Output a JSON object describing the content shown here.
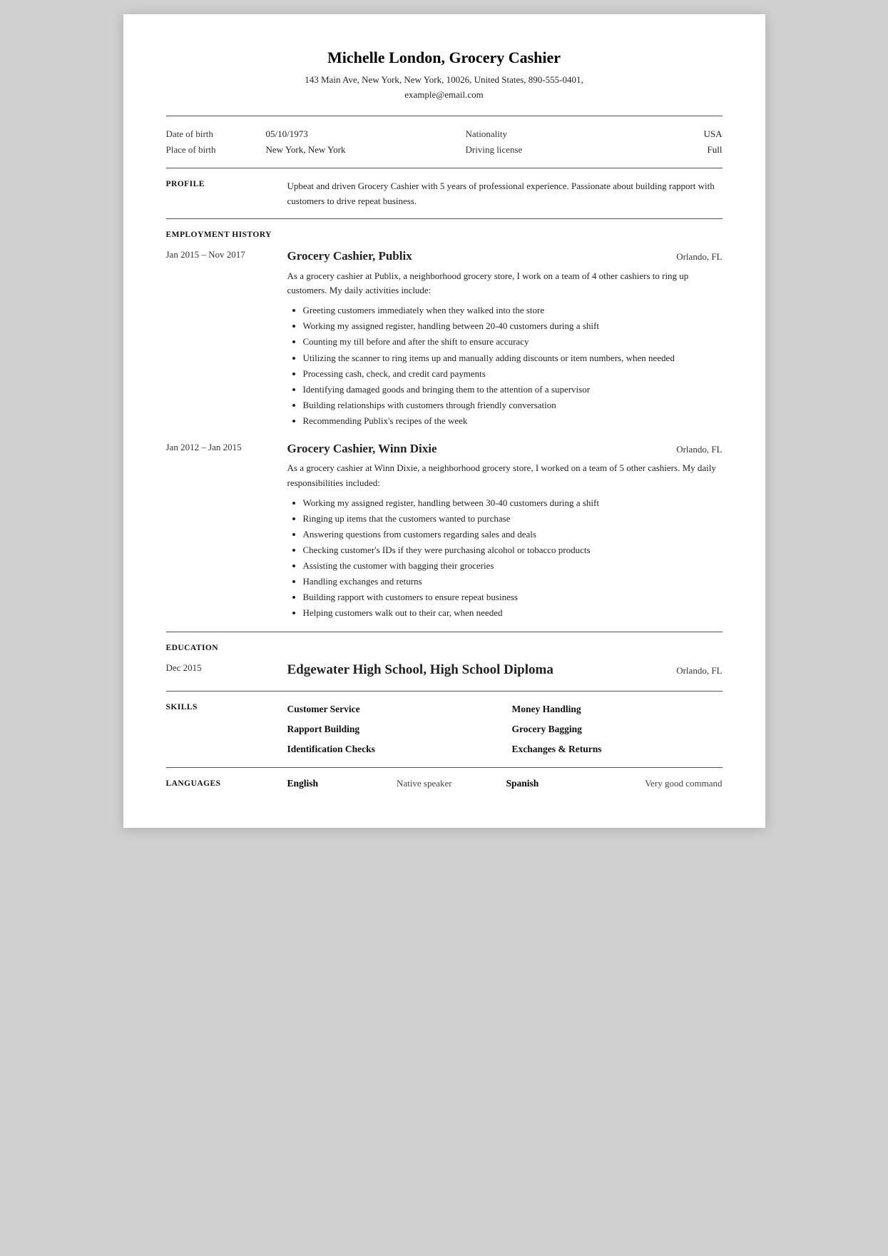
{
  "header": {
    "name": "Michelle London, Grocery Cashier",
    "address": "143 Main Ave, New York, New York, 10026, United States, 890-555-0401,",
    "email": "example@email.com"
  },
  "personal": {
    "dob_label": "Date of birth",
    "dob_value": "05/10/1973",
    "nationality_label": "Nationality",
    "nationality_value": "USA",
    "pob_label": "Place of birth",
    "pob_value": "New York, New York",
    "driving_label": "Driving license",
    "driving_value": "Full"
  },
  "profile": {
    "section_label": "PROFILE",
    "text": "Upbeat and driven Grocery Cashier with 5 years of professional experience. Passionate about building rapport with customers to drive repeat business."
  },
  "employment": {
    "section_label": "EMPLOYMENT HISTORY",
    "jobs": [
      {
        "date": "Jan 2015 – Nov 2017",
        "title": "Grocery Cashier, Publix",
        "location": "Orlando, FL",
        "description": "As a grocery cashier at Publix, a neighborhood grocery store, I work on a team of 4 other cashiers to ring up customers. My daily activities include:",
        "bullets": [
          "Greeting customers immediately when they walked into the store",
          "Working my assigned register, handling between 20-40 customers during a shift",
          "Counting my till before and after the shift to ensure accuracy",
          "Utilizing the scanner to ring items up and manually adding discounts or item numbers, when needed",
          "Processing cash, check, and credit card payments",
          "Identifying damaged goods and bringing them to the attention of a supervisor",
          "Building relationships with customers through friendly conversation",
          "Recommending Publix's recipes of the week"
        ]
      },
      {
        "date": "Jan 2012 – Jan 2015",
        "title": "Grocery Cashier, Winn Dixie",
        "location": "Orlando, FL",
        "description": "As a grocery cashier at Winn Dixie, a neighborhood grocery store, I worked on a team of 5 other cashiers. My daily responsibilities included:",
        "bullets": [
          "Working my assigned register, handling between 30-40 customers during a shift",
          "Ringing up items that the customers wanted to purchase",
          "Answering questions from customers regarding sales and deals",
          "Checking customer's IDs if they were purchasing alcohol or tobacco products",
          "Assisting the customer with bagging their groceries",
          "Handling exchanges and returns",
          "Building rapport with customers to ensure repeat business",
          "Helping customers walk out to their car, when needed"
        ]
      }
    ]
  },
  "education": {
    "section_label": "EDUCATION",
    "date": "Dec 2015",
    "title": "Edgewater High School, High School Diploma",
    "location": "Orlando, FL"
  },
  "skills": {
    "section_label": "SKILLS",
    "items": [
      [
        "Customer Service",
        "Money Handling"
      ],
      [
        "Rapport Building",
        "Grocery Bagging"
      ],
      [
        "Identification Checks",
        "Exchanges & Returns"
      ]
    ]
  },
  "languages": {
    "section_label": "LANGUAGES",
    "items": [
      {
        "name": "English",
        "level": "Native speaker",
        "name2": "Spanish",
        "level2": "Very good command"
      }
    ]
  }
}
